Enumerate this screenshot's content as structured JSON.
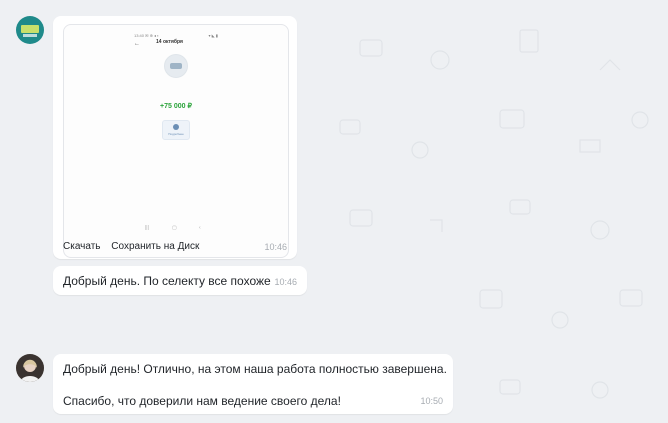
{
  "chat": {
    "messages": [
      {
        "sender": "first",
        "type": "image",
        "image": {
          "status_left": "13:40 ✉ ⊕ ◂ ▪",
          "status_right": "▾ ◣ ▮",
          "back_icon": "←",
          "date": "14 октября",
          "amount": "+75 000 ₽",
          "mini_button": "Подробнее"
        },
        "actions": [
          "Скачать",
          "Сохранить на Диск"
        ],
        "time": "10:46"
      },
      {
        "sender": "first",
        "type": "text",
        "text": "Добрый день. По селекту все похоже",
        "time": "10:46"
      },
      {
        "sender": "second",
        "type": "text",
        "text_line1": "Добрый день! Отлично, на этом наша работа полностью завершена.",
        "text_line2": "Спасибо, что доверили нам ведение своего дела!",
        "time": "10:50"
      }
    ]
  },
  "colors": {
    "background": "#eef0f3",
    "bubble": "#ffffff",
    "amount": "#2aa33a",
    "timestamp": "#a7acb2"
  }
}
